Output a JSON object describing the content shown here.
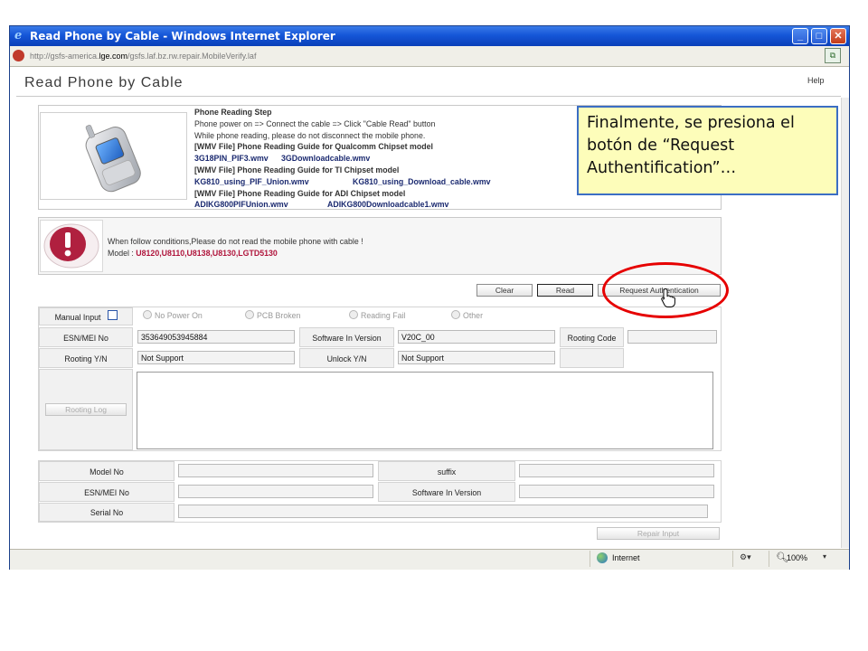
{
  "window": {
    "title": "Read Phone by Cable - Windows Internet Explorer",
    "url_prefix": "http://gsfs-america.",
    "url_domain": "lge.com",
    "url_suffix": "/gsfs.laf.bz.rw.repair.MobileVerify.laf"
  },
  "header": {
    "title": "Read Phone by Cable",
    "help": "Help"
  },
  "steps": {
    "heading": "Phone Reading Step",
    "line1": "Phone power on => Connect the cable => Click \"Cable Read\" button",
    "line2": "While phone reading, please do not disconnect the mobile phone.",
    "qualcomm_title": "[WMV File] Phone Reading Guide for Qualcomm Chipset model",
    "qualcomm_links": [
      "3G18PIN_PIF3.wmv",
      "3GDownloadcable.wmv"
    ],
    "ti_title": "[WMV File] Phone Reading Guide for TI Chipset model",
    "ti_links": [
      "KG810_using_PIF_Union.wmv",
      "KG810_using_Download_cable.wmv"
    ],
    "adi_title": "[WMV File] Phone Reading Guide for ADI Chipset model",
    "adi_links": [
      "ADIKG800PIFUnion.wmv",
      "ADIKG800Downloadcable1.wmv"
    ]
  },
  "warning": {
    "message": "When follow conditions,Please do not read the mobile phone with cable !",
    "model_label": "Model : ",
    "model_values": "U8120,U8110,U8138,U8130,LGTD5130"
  },
  "actions": {
    "clear": "Clear",
    "read": "Read",
    "request_auth": "Request Authentication"
  },
  "form": {
    "manual_input": "Manual Input",
    "radios": [
      "No Power On",
      "PCB Broken",
      "Reading Fail",
      "Other"
    ],
    "esn_label": "ESN/MEI No",
    "esn_value": "353649053945884",
    "sw_label": "Software In Version",
    "sw_value": "V20C_00",
    "rooting_code_label": "Rooting Code",
    "rooting_yn_label": "Rooting Y/N",
    "rooting_yn_value": "Not Support",
    "unlock_label": "Unlock Y/N",
    "unlock_value": "Not Support",
    "rooting_log": "Rooting Log"
  },
  "result": {
    "model_label": "Model No",
    "suffix_label": "suffix",
    "esn_label": "ESN/MEI No",
    "sw_label": "Software In Version",
    "serial_label": "Serial No",
    "repair_input": "Repair Input"
  },
  "statusbar": {
    "zone": "Internet",
    "zoom": "100%"
  },
  "callout": {
    "text": "Finalmente, se presiona el botón de “Request Authentification”…"
  }
}
